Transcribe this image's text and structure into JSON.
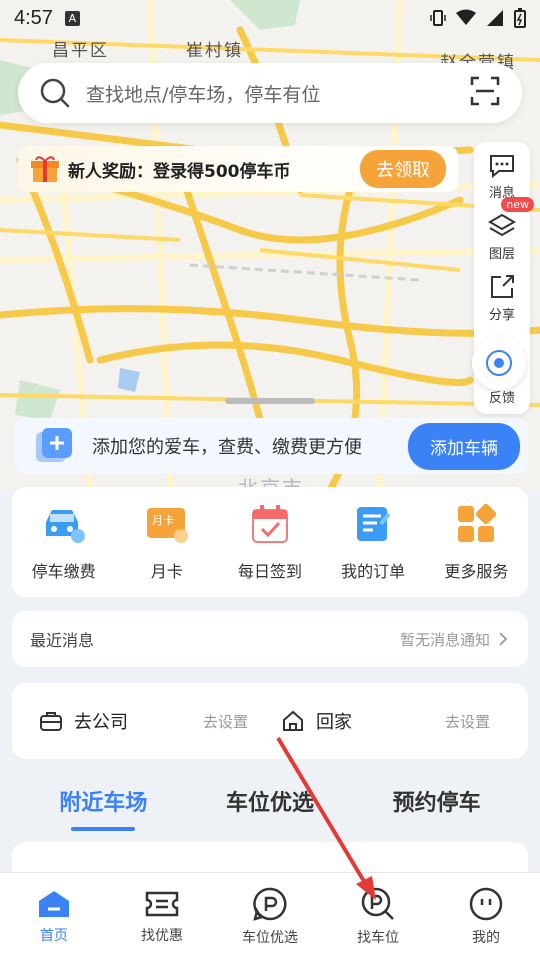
{
  "status_bar": {
    "time": "4:57",
    "notification_badge": "A"
  },
  "map": {
    "labels": [
      "昌平区",
      "崔村镇",
      "赵全营镇",
      "北京市"
    ],
    "road_color": "#f7c948"
  },
  "search": {
    "placeholder": "查找地点/停车场，停车有位"
  },
  "promo": {
    "text": "新人奖励：登录得500停车币",
    "button": "去领取"
  },
  "toolbar": {
    "items": [
      {
        "label": "消息",
        "icon": "message-icon"
      },
      {
        "label": "图层",
        "icon": "layers-icon",
        "badge": "new"
      },
      {
        "label": "分享",
        "icon": "share-icon"
      },
      {
        "label": "反馈",
        "icon": "feedback-icon"
      }
    ]
  },
  "add_car": {
    "text": "添加您的爱车，查费、缴费更方便",
    "button": "添加车辆"
  },
  "quick_menu": [
    {
      "label": "停车缴费",
      "icon": "parking-pay-icon"
    },
    {
      "label": "月卡",
      "icon": "monthly-card-icon",
      "icon_text": "月卡"
    },
    {
      "label": "每日签到",
      "icon": "daily-checkin-icon"
    },
    {
      "label": "我的订单",
      "icon": "orders-icon"
    },
    {
      "label": "更多服务",
      "icon": "more-services-icon"
    }
  ],
  "messages": {
    "title": "最近消息",
    "status": "暂无消息通知"
  },
  "shortcuts": [
    {
      "name": "去公司",
      "action": "去设置",
      "icon": "briefcase-icon"
    },
    {
      "name": "回家",
      "action": "去设置",
      "icon": "home-icon"
    }
  ],
  "tabs": [
    {
      "label": "附近车场",
      "active": true
    },
    {
      "label": "车位优选",
      "active": false
    },
    {
      "label": "预约停车",
      "active": false
    }
  ],
  "bottom_nav": [
    {
      "label": "首页",
      "icon": "home-nav-icon",
      "active": true
    },
    {
      "label": "找优惠",
      "icon": "coupon-icon",
      "active": false
    },
    {
      "label": "车位优选",
      "icon": "spot-select-icon",
      "active": false
    },
    {
      "label": "找车位",
      "icon": "find-parking-icon",
      "active": false
    },
    {
      "label": "我的",
      "icon": "profile-icon",
      "active": false
    }
  ],
  "colors": {
    "accent": "#3b82f6",
    "promo_button": "#f6a33a",
    "annotation_arrow": "#e53935"
  }
}
